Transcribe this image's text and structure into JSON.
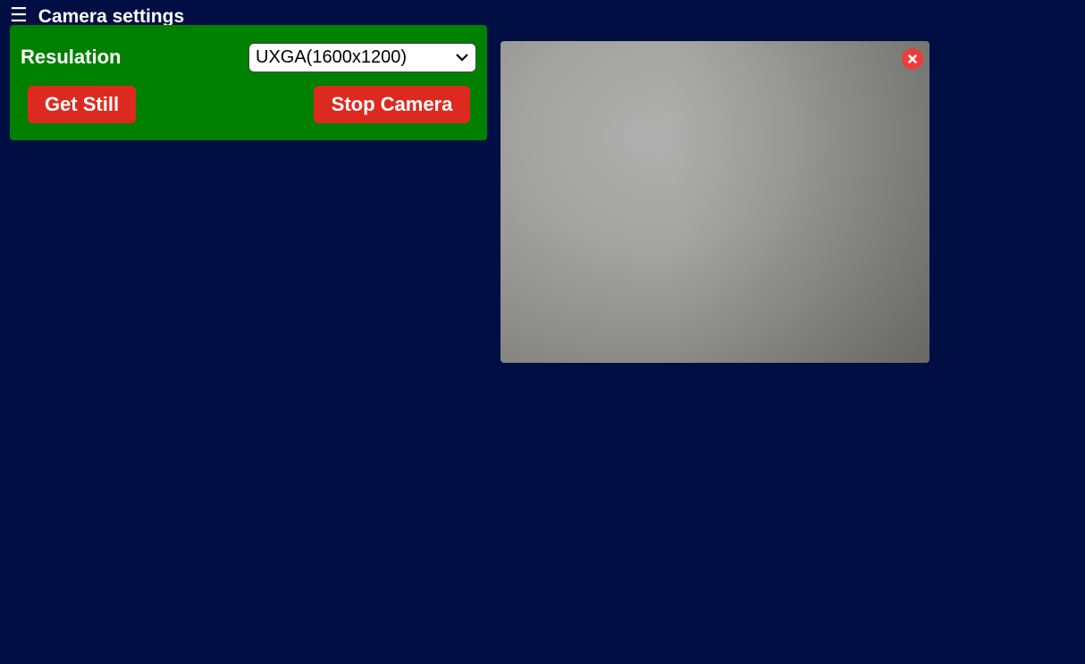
{
  "header": {
    "menu_icon": "hamburger-menu-icon",
    "title": "Camera settings"
  },
  "settings_panel": {
    "resolution_label": "Resulation",
    "resolution_select": {
      "selected": "UXGA(1600x1200)"
    },
    "get_still_label": "Get Still",
    "stop_camera_label": "Stop Camera"
  },
  "stream": {
    "close_icon": "close-x-icon"
  },
  "colors": {
    "background": "#000e44",
    "panel": "#008000",
    "button": "#dd2a20",
    "close": "#ef3b3b"
  }
}
